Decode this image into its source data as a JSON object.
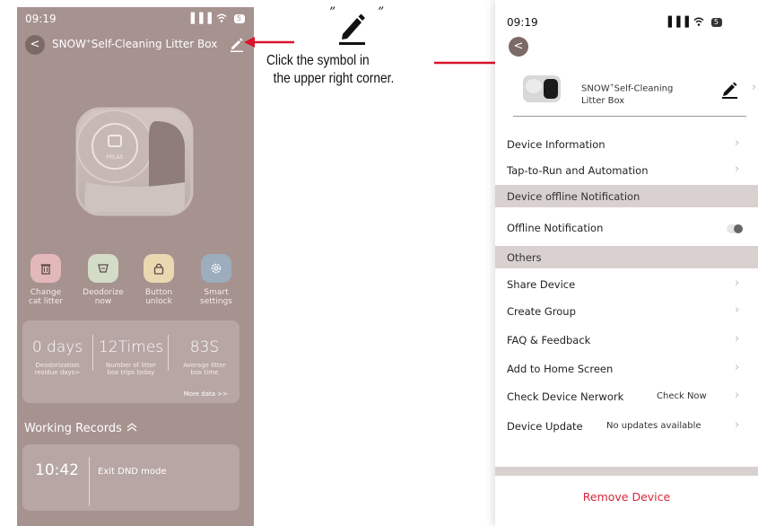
{
  "left_screen": {
    "status": {
      "time": "09:19",
      "signal": "▐▐▐",
      "battery": "5"
    },
    "header": {
      "back": "<",
      "title": "SNOW",
      "title_sup": "+",
      "title_rest": "Self-Cleaning Litter Box"
    },
    "actions": [
      {
        "label": "Change\ncat litter",
        "icon": "trash-icon",
        "color": "#e3b8bb"
      },
      {
        "label": "Deodorize\nnow",
        "icon": "deodorize-icon",
        "color": "#d3dcc6"
      },
      {
        "label": "Button\nunlock",
        "icon": "unlock-icon",
        "color": "#ead9b0"
      },
      {
        "label": "Smart\nsettings",
        "icon": "gear-icon",
        "color": "#9eadbd"
      }
    ],
    "stats": [
      {
        "value": "0 days",
        "caption": "Deodorization\nresidue days>"
      },
      {
        "value": "12Times",
        "caption": "Number of litter\nbox trips today"
      },
      {
        "value": "83S",
        "caption": "Average litter\nbox time"
      }
    ],
    "more_data": "More data >>",
    "working_records_title": "Working Records",
    "record": {
      "time": "10:42",
      "event": "Exit DND mode"
    }
  },
  "annotation": {
    "quote_open": "”",
    "quote_close": "”",
    "instruction": "Click the symbol in\n  the upper right corner.",
    "arrow_color": "#d9142b"
  },
  "right_screen": {
    "status": {
      "time": "09:19",
      "signal": "▐▐▐",
      "battery": "5"
    },
    "back": "<",
    "device_name_a": "SNOW",
    "device_name_sup": "+",
    "device_name_b": "Self-Cleaning Litter Box",
    "chevron": "›",
    "rows": {
      "device_information": "Device Information",
      "tap_to_run": "Tap-to-Run and Automation",
      "offline_section": "Device offline Notification",
      "offline_notification": "Offline Notification",
      "others_section": "Others",
      "share_device": "Share Device",
      "create_group": "Create Group",
      "faq": "FAQ & Feedback",
      "add_home": "Add to Home Screen",
      "check_network": "Check Device Nerwork",
      "check_now": "Check Now",
      "device_update": "Device Update",
      "no_updates": "No updates available"
    },
    "remove_device": "Remove Device",
    "remove_color": "#d9263a"
  }
}
